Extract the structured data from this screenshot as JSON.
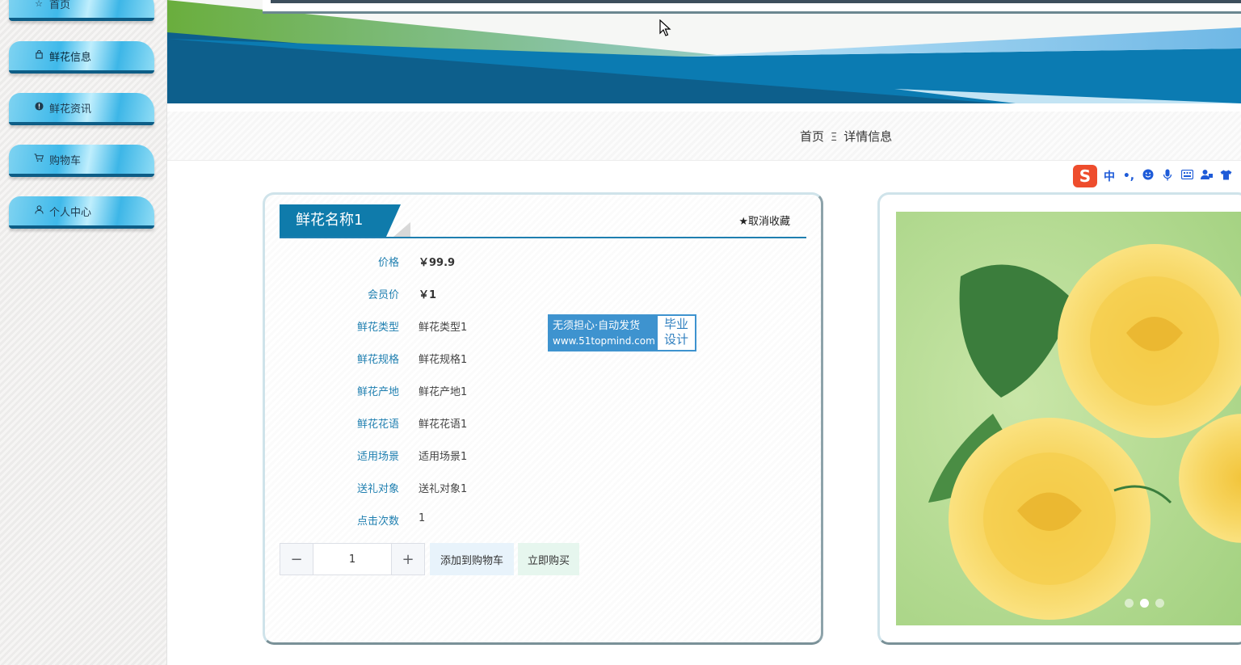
{
  "sidebar": {
    "items": [
      {
        "label": "首页",
        "icon": "star-icon"
      },
      {
        "label": "鲜花信息",
        "icon": "bag-icon"
      },
      {
        "label": "鲜花资讯",
        "icon": "info-icon"
      },
      {
        "label": "购物车",
        "icon": "cart-icon"
      },
      {
        "label": "个人中心",
        "icon": "user-icon"
      }
    ]
  },
  "breadcrumb": {
    "home": "首页",
    "separator": "Ξ",
    "current": "详情信息"
  },
  "ime": {
    "logo": "S",
    "lang": "中",
    "punct": "•,"
  },
  "product": {
    "name": "鲜花名称1",
    "favorite_label": "取消收藏",
    "fields": [
      {
        "label": "价格",
        "value": "￥99.9"
      },
      {
        "label": "会员价",
        "value": "￥1"
      },
      {
        "label": "鲜花类型",
        "value": "鲜花类型1"
      },
      {
        "label": "鲜花规格",
        "value": "鲜花规格1"
      },
      {
        "label": "鲜花产地",
        "value": "鲜花产地1"
      },
      {
        "label": "鲜花花语",
        "value": "鲜花花语1"
      },
      {
        "label": "适用场景",
        "value": "适用场景1"
      },
      {
        "label": "送礼对象",
        "value": "送礼对象1"
      },
      {
        "label": "点击次数",
        "value": "1"
      }
    ],
    "quantity": "1",
    "minus_label": "−",
    "plus_label": "+",
    "add_to_cart_label": "添加到购物车",
    "buy_now_label": "立即购买"
  },
  "watermark": {
    "line1": "无须担心·自动发货",
    "line2": "www.51topmind.com",
    "right1": "毕业",
    "right2": "设计"
  },
  "gallery": {
    "active_index": 1,
    "count": 3
  },
  "colors": {
    "primary": "#0f7bab",
    "label_blue": "#1f7fb0",
    "nav_blue": "#3fb9ea",
    "banner_green": "#6aae3d"
  }
}
